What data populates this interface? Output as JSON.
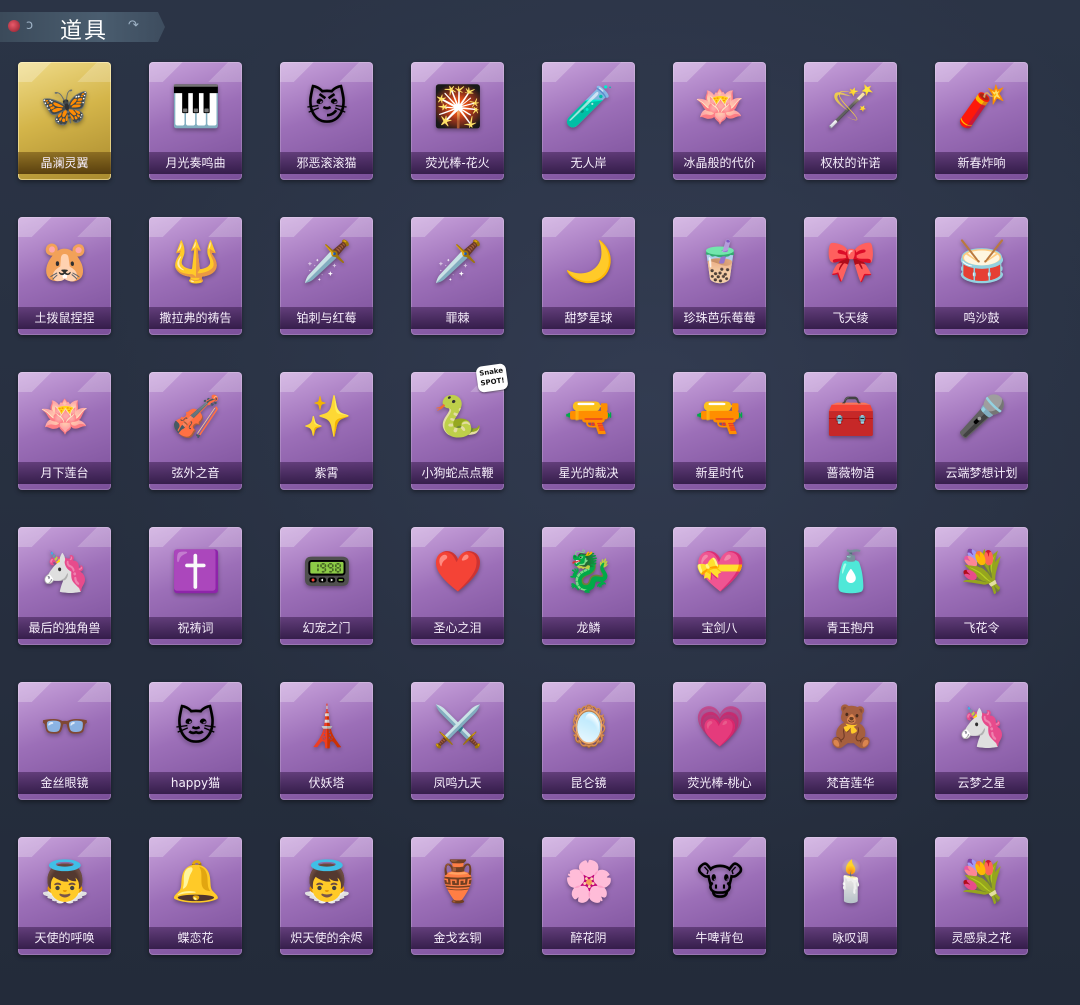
{
  "header": {
    "title": "道具"
  },
  "badge": {
    "text": "Snake SPOT!"
  },
  "items": [
    {
      "label": "晶澜灵翼",
      "icon": "butterfly-wings-icon",
      "glyph": "🦋",
      "rarity": "gold"
    },
    {
      "label": "月光奏鸣曲",
      "icon": "piano-icon",
      "glyph": "🎹",
      "rarity": "purple"
    },
    {
      "label": "邪恶滚滚猫",
      "icon": "cat-ball-icon",
      "glyph": "😼",
      "rarity": "purple"
    },
    {
      "label": "荧光棒-花火",
      "icon": "sparkler-icon",
      "glyph": "🎇",
      "rarity": "purple"
    },
    {
      "label": "无人岸",
      "icon": "perfume-bottle-icon",
      "glyph": "🧪",
      "rarity": "purple"
    },
    {
      "label": "冰晶般的代价",
      "icon": "crystal-lotus-icon",
      "glyph": "🪷",
      "rarity": "purple"
    },
    {
      "label": "权杖的许诺",
      "icon": "scepter-icon",
      "glyph": "🪄",
      "rarity": "purple"
    },
    {
      "label": "新春炸响",
      "icon": "firecracker-icon",
      "glyph": "🧨",
      "rarity": "purple"
    },
    {
      "label": "土拨鼠捏捏",
      "icon": "hamster-icon",
      "glyph": "🐹",
      "rarity": "purple"
    },
    {
      "label": "撒拉弗的祷告",
      "icon": "staff-icon",
      "glyph": "🔱",
      "rarity": "purple"
    },
    {
      "label": "铂刺与红莓",
      "icon": "rose-blade-icon",
      "glyph": "🗡️",
      "rarity": "purple"
    },
    {
      "label": "罪棘",
      "icon": "spear-icon",
      "glyph": "🗡️",
      "rarity": "purple"
    },
    {
      "label": "甜梦星球",
      "icon": "moon-fox-icon",
      "glyph": "🌙",
      "rarity": "purple"
    },
    {
      "label": "珍珠芭乐莓莓",
      "icon": "bubble-tea-icon",
      "glyph": "🧋",
      "rarity": "purple"
    },
    {
      "label": "飞天绫",
      "icon": "ribbon-icon",
      "glyph": "🎀",
      "rarity": "purple"
    },
    {
      "label": "鸣沙鼓",
      "icon": "drum-icon",
      "glyph": "🥁",
      "rarity": "purple"
    },
    {
      "label": "月下莲台",
      "icon": "lotus-wand-icon",
      "glyph": "🪷",
      "rarity": "purple"
    },
    {
      "label": "弦外之音",
      "icon": "lute-icon",
      "glyph": "🎻",
      "rarity": "purple"
    },
    {
      "label": "紫霄",
      "icon": "golden-staff-icon",
      "glyph": "✨",
      "rarity": "purple"
    },
    {
      "label": "小狗蛇点点鞭",
      "icon": "snake-icon",
      "glyph": "🐍",
      "rarity": "purple"
    },
    {
      "label": "星光的裁决",
      "icon": "flintlock-icon",
      "glyph": "🔫",
      "rarity": "purple"
    },
    {
      "label": "新星时代",
      "icon": "revolver-icon",
      "glyph": "🔫",
      "rarity": "purple"
    },
    {
      "label": "蔷薇物语",
      "icon": "first-aid-kit-icon",
      "glyph": "🧰",
      "rarity": "purple"
    },
    {
      "label": "云端梦想计划",
      "icon": "microphone-icon",
      "glyph": "🎤",
      "rarity": "purple"
    },
    {
      "label": "最后的独角兽",
      "icon": "unicorn-sword-icon",
      "glyph": "🦄",
      "rarity": "purple"
    },
    {
      "label": "祝祷词",
      "icon": "cross-icon",
      "glyph": "✝️",
      "rarity": "purple"
    },
    {
      "label": "幻宠之门",
      "icon": "gadget-icon",
      "glyph": "📟",
      "rarity": "purple"
    },
    {
      "label": "圣心之泪",
      "icon": "heart-scepter-icon",
      "glyph": "❤️",
      "rarity": "purple"
    },
    {
      "label": "龙鳞",
      "icon": "golden-shovel-icon",
      "glyph": "🐉",
      "rarity": "purple"
    },
    {
      "label": "宝剑八",
      "icon": "heart-frame-icon",
      "glyph": "💝",
      "rarity": "purple"
    },
    {
      "label": "青玉抱丹",
      "icon": "potion-icon",
      "glyph": "🧴",
      "rarity": "purple"
    },
    {
      "label": "飞花令",
      "icon": "flower-lantern-icon",
      "glyph": "💐",
      "rarity": "purple"
    },
    {
      "label": "金丝眼镜",
      "icon": "glasses-icon",
      "glyph": "👓",
      "rarity": "purple"
    },
    {
      "label": "happy猫",
      "icon": "cat-icon",
      "glyph": "🐱",
      "rarity": "purple"
    },
    {
      "label": "伏妖塔",
      "icon": "pagoda-icon",
      "glyph": "🗼",
      "rarity": "purple"
    },
    {
      "label": "凤鸣九天",
      "icon": "phoenix-sword-icon",
      "glyph": "⚔️",
      "rarity": "purple"
    },
    {
      "label": "昆仑镜",
      "icon": "mirror-icon",
      "glyph": "🪞",
      "rarity": "purple"
    },
    {
      "label": "荧光棒-桃心",
      "icon": "heart-wand-icon",
      "glyph": "💗",
      "rarity": "purple"
    },
    {
      "label": "梵音莲华",
      "icon": "doll-icon",
      "glyph": "🧸",
      "rarity": "purple"
    },
    {
      "label": "云梦之星",
      "icon": "unicorn-cloud-icon",
      "glyph": "🦄",
      "rarity": "purple"
    },
    {
      "label": "天使的呼唤",
      "icon": "angel-doll-icon",
      "glyph": "👼",
      "rarity": "purple"
    },
    {
      "label": "蝶恋花",
      "icon": "bell-icon",
      "glyph": "🔔",
      "rarity": "purple"
    },
    {
      "label": "炽天使的余烬",
      "icon": "angel-girl-icon",
      "glyph": "👼",
      "rarity": "purple"
    },
    {
      "label": "金戈玄铜",
      "icon": "bronze-vessel-icon",
      "glyph": "🏺",
      "rarity": "purple"
    },
    {
      "label": "醉花阴",
      "icon": "flower-ornament-icon",
      "glyph": "🌸",
      "rarity": "purple"
    },
    {
      "label": "牛啤背包",
      "icon": "cow-backpack-icon",
      "glyph": "🐮",
      "rarity": "purple"
    },
    {
      "label": "咏叹调",
      "icon": "chandelier-icon",
      "glyph": "🕯️",
      "rarity": "purple"
    },
    {
      "label": "灵感泉之花",
      "icon": "bouquet-icon",
      "glyph": "💐",
      "rarity": "purple"
    }
  ]
}
